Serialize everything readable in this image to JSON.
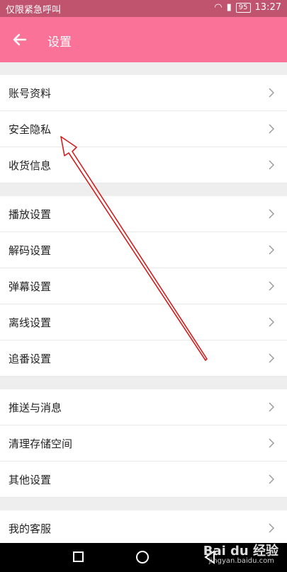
{
  "status": {
    "left_text": "仅限紧急呼叫",
    "battery": "95",
    "time": "13:27"
  },
  "appbar": {
    "title": "设置"
  },
  "groups": [
    [
      "账号资料",
      "安全隐私",
      "收货信息"
    ],
    [
      "播放设置",
      "解码设置",
      "弹幕设置",
      "离线设置",
      "追番设置"
    ],
    [
      "推送与消息",
      "清理存储空间",
      "其他设置"
    ],
    [
      "我的客服"
    ]
  ],
  "watermark": {
    "main": "Bai du 经验",
    "sub": "jingyan.baidu.com"
  },
  "colors": {
    "appbar": "#fb7299",
    "statusbar": "#c0536e",
    "annotation": "#d11f1f"
  }
}
